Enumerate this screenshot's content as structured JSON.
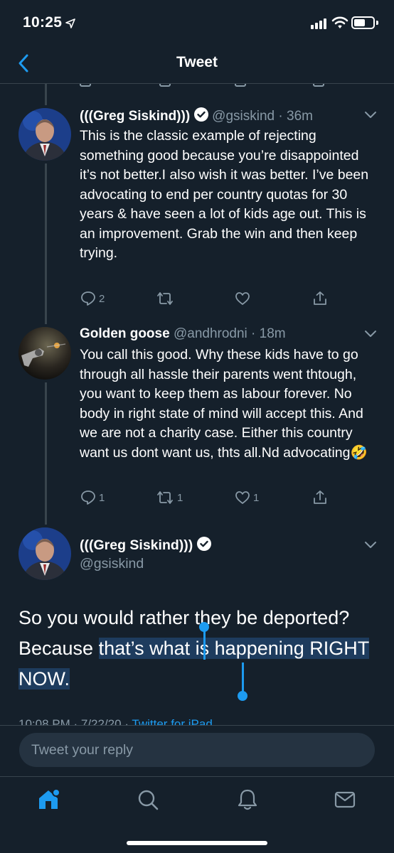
{
  "status_bar": {
    "time": "10:25"
  },
  "nav": {
    "title": "Tweet"
  },
  "replies": [
    {
      "name": "(((Greg Siskind)))",
      "handle": "@gsiskind",
      "time": "36m",
      "text": "This is the classic example of rejecting something good because you’re disappointed it’s not better.I also wish it was better. I’ve been advocating to end per country quotas for 30 years & have seen a lot of kids age out. This is an improvement. Grab the win and then keep trying.",
      "reply_count": "2",
      "retweet_count": "",
      "like_count": ""
    },
    {
      "name": "Golden goose",
      "handle": "@andhrodni",
      "time": "18m",
      "text": "You call this good. Why these kids have to go through all hassle their parents went thtough, you want to keep them as labour forever. No body in right state of mind will accept this. And we are not a charity case. Either this country want us dont want us, thts all.Nd advocating🤣",
      "reply_count": "1",
      "retweet_count": "1",
      "like_count": "1"
    }
  ],
  "main_tweet": {
    "name": "(((Greg Siskind)))",
    "handle": "@gsiskind",
    "text_part1": "So you would rather they be deported? Because ",
    "text_selected": "that’s what is happening RIGHT NOW.",
    "meta_time": "10:08 PM · 7/22/20 · ",
    "meta_source": "Twitter for iPad"
  },
  "reply_bar": {
    "placeholder": "Tweet your reply"
  },
  "colors": {
    "background": "#15202b",
    "accent": "#1d9bf0",
    "secondary_text": "#8899a6",
    "border": "#38444d"
  },
  "tabs": [
    "home-icon",
    "search-icon",
    "notifications-icon",
    "messages-icon"
  ]
}
